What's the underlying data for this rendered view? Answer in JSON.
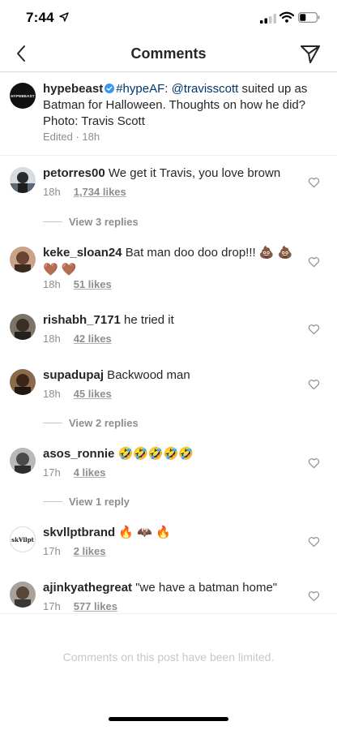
{
  "status_bar": {
    "time": "7:44"
  },
  "nav": {
    "title": "Comments"
  },
  "caption": {
    "avatar_text": "HYPEBEAST",
    "username": "hypebeast",
    "hashtag": "#hypeAF",
    "mention": "@travisscott",
    "text": " suited up as Batman for Halloween. Thoughts on how he did? Photo: Travis Scott",
    "meta": "Edited · 18h"
  },
  "comments": [
    {
      "username": "petorres00",
      "text": " We get it Travis, you love brown",
      "time": "18h",
      "likes": "1,734 likes",
      "replies": "View 3 replies"
    },
    {
      "username": "keke_sloan24",
      "text": " Bat man doo doo drop!!! 💩 💩 🤎 🤎",
      "time": "18h",
      "likes": "51 likes"
    },
    {
      "username": "rishabh_7171",
      "text": " he tried it",
      "time": "18h",
      "likes": "42 likes"
    },
    {
      "username": "supadupaj",
      "text": " Backwood man",
      "time": "18h",
      "likes": "45 likes",
      "replies": "View 2 replies"
    },
    {
      "username": "asos_ronnie",
      "text": " 🤣🤣🤣🤣🤣",
      "time": "17h",
      "likes": "4 likes",
      "replies": "View 1 reply"
    },
    {
      "username": "skvllptbrand",
      "text": " 🔥 🦇 🔥",
      "time": "17h",
      "likes": "2 likes",
      "avatar_text": "skⱯllpt"
    },
    {
      "username": "ajinkyathegreat",
      "text": " \"we have a batman home\"",
      "time": "17h",
      "likes": "577 likes"
    }
  ],
  "footer": {
    "limited_text": "Comments on this post have been limited."
  },
  "colors": {
    "link": "#00376b",
    "secondary": "#8e8e8e",
    "verified": "#3897f0",
    "border": "#dbdbdb"
  },
  "icons": {
    "back": "chevron-left-icon",
    "direct": "paper-plane-icon",
    "like": "heart-outline-icon",
    "verified": "verified-badge-icon"
  }
}
